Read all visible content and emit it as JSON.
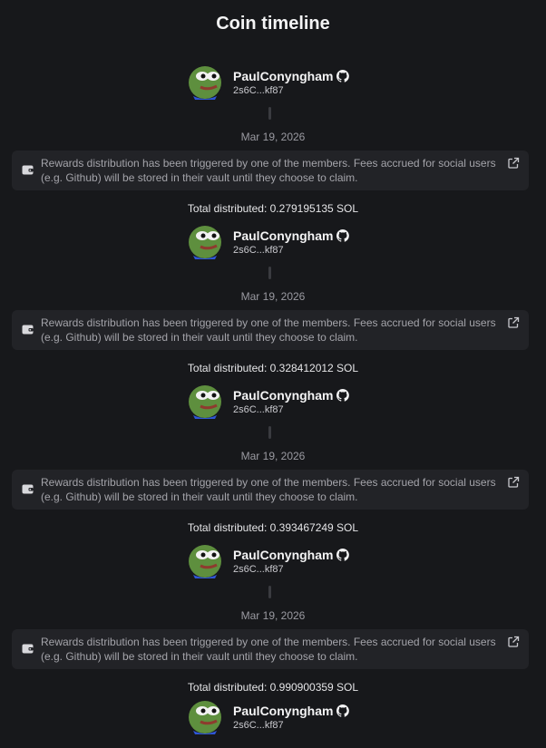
{
  "page": {
    "title": "Coin timeline"
  },
  "user": {
    "name": "PaulConyngham",
    "address": "2s6C...kf87"
  },
  "events": [
    {
      "date": "Mar 19, 2026",
      "message": "Rewards distribution has been triggered by one of the members. Fees accrued for social users (e.g. Github) will be stored in their vault until they choose to claim.",
      "total": "Total distributed: 0.279195135 SOL"
    },
    {
      "date": "Mar 19, 2026",
      "message": "Rewards distribution has been triggered by one of the members. Fees accrued for social users (e.g. Github) will be stored in their vault until they choose to claim.",
      "total": "Total distributed: 0.328412012 SOL"
    },
    {
      "date": "Mar 19, 2026",
      "message": "Rewards distribution has been triggered by one of the members. Fees accrued for social users (e.g. Github) will be stored in their vault until they choose to claim.",
      "total": "Total distributed: 0.393467249 SOL"
    },
    {
      "date": "Mar 19, 2026",
      "message": "Rewards distribution has been triggered by one of the members. Fees accrued for social users (e.g. Github) will be stored in their vault until they choose to claim.",
      "total": "Total distributed: 0.990900359 SOL"
    }
  ],
  "icons": {
    "avatar": "frog-avatar",
    "github": "github-icon",
    "wallet": "wallet-icon",
    "external": "external-link-icon"
  },
  "colors": {
    "background": "#17181b",
    "card": "#222327",
    "text": "#e6e6e8",
    "muted": "#a4a4aa"
  }
}
